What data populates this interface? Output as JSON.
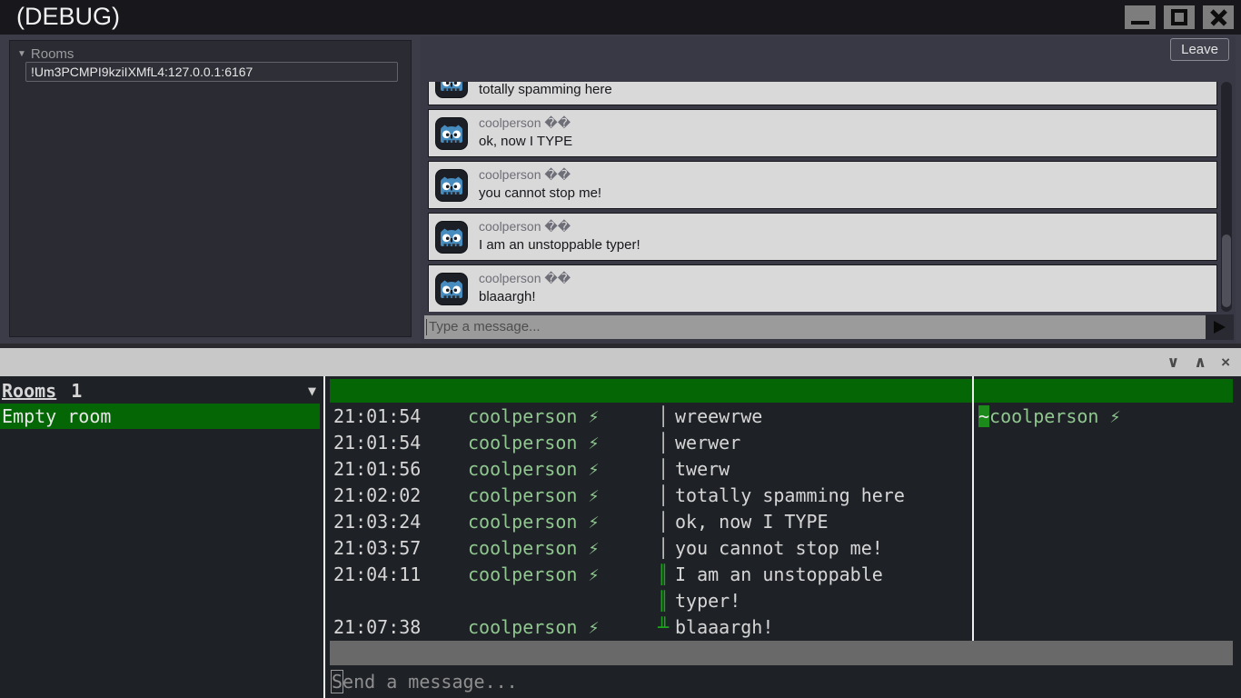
{
  "window": {
    "title": "(DEBUG)"
  },
  "colors": {
    "accent_green": "#056605",
    "marker_green": "#1da21d",
    "nick_green": "#8fc78f",
    "card_bg": "#d9d9d9",
    "godot_blue": "#478cbf"
  },
  "rooms_panel": {
    "tree_arrow": "▼",
    "tree_label": "Rooms",
    "room_id": "!Um3PCMPI9kziIXMfL4:127.0.0.1:6167"
  },
  "chat_panel": {
    "leave_button_label": "Leave",
    "messages": [
      {
        "author": "coolperson ��",
        "text": "totally spamming here",
        "partial": true
      },
      {
        "author": "coolperson ��",
        "text": "ok, now I TYPE",
        "partial": false
      },
      {
        "author": "coolperson ��",
        "text": "you cannot stop me!",
        "partial": false
      },
      {
        "author": "coolperson ��",
        "text": "I am an unstoppable typer!",
        "partial": false
      },
      {
        "author": "coolperson ��",
        "text": "blaaargh!",
        "partial": false
      }
    ],
    "input_placeholder": "Type a message..."
  },
  "terminal_panel": {
    "topbar_icons": {
      "collapse": "∨",
      "expand": "∧",
      "close": "×"
    },
    "buffer_list": {
      "header_title": "Rooms",
      "header_count": "1",
      "dropdown_icon": "▼",
      "items": [
        {
          "name": "Empty room",
          "selected": true
        }
      ]
    },
    "log": [
      {
        "time": "21:01:54",
        "nick": "coolperson ⚡",
        "sep": "│",
        "marker": false,
        "text": "wreewrwe"
      },
      {
        "time": "21:01:54",
        "nick": "coolperson ⚡",
        "sep": "│",
        "marker": false,
        "text": "werwer"
      },
      {
        "time": "21:01:56",
        "nick": "coolperson ⚡",
        "sep": "│",
        "marker": false,
        "text": "twerw"
      },
      {
        "time": "21:02:02",
        "nick": "coolperson ⚡",
        "sep": "│",
        "marker": false,
        "text": "totally spamming here"
      },
      {
        "time": "21:03:24",
        "nick": "coolperson ⚡",
        "sep": "│",
        "marker": false,
        "text": "ok, now I TYPE"
      },
      {
        "time": "21:03:57",
        "nick": "coolperson ⚡",
        "sep": "│",
        "marker": false,
        "text": "you cannot stop me!"
      },
      {
        "time": "21:04:11",
        "nick": "coolperson ⚡",
        "sep": "║",
        "marker": true,
        "text": "I am an unstoppable"
      },
      {
        "time": "",
        "nick": "",
        "sep": "║",
        "marker": true,
        "text": "typer!"
      },
      {
        "time": "21:07:38",
        "nick": "coolperson ⚡",
        "sep": "╨",
        "marker": true,
        "text": "blaaargh!"
      }
    ],
    "userlist": [
      {
        "prefix": "~",
        "nick": "coolperson ⚡"
      }
    ],
    "input_placeholder": "Send a message..."
  }
}
